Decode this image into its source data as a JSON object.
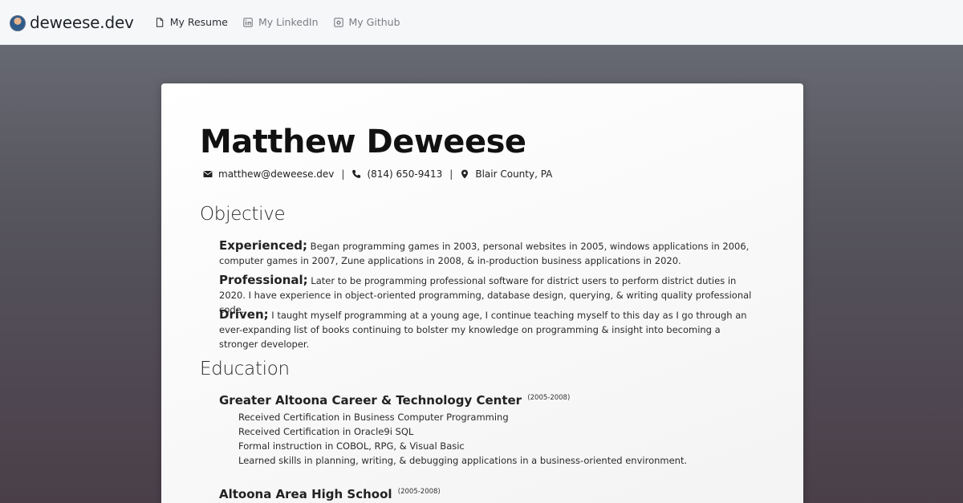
{
  "nav": {
    "brand": "deweese.dev",
    "links": [
      {
        "label": "My Resume",
        "icon": "document-icon",
        "active": true
      },
      {
        "label": "My LinkedIn",
        "icon": "linkedin-icon",
        "active": false
      },
      {
        "label": "My Github",
        "icon": "github-icon",
        "active": false
      }
    ]
  },
  "resume": {
    "name": "Matthew Deweese",
    "contact": {
      "email": "matthew@deweese.dev",
      "phone": "(814) 650-9413",
      "location": "Blair County, PA",
      "separator": "|"
    },
    "objective": {
      "title": "Objective",
      "items": [
        {
          "lead": "Experienced;",
          "text": " Began programming games in 2003, personal websites in 2005, windows applications in 2006, computer games in 2007, Zune applications in 2008, & in-production business applications in 2020."
        },
        {
          "lead": "Professional;",
          "text": " Later to be programming professional software for district users to perform district duties in 2020. I have experience in object-oriented programming, database design, querying, & writing quality professional code."
        },
        {
          "lead": "Driven;",
          "text": " I taught myself programming at a young age, I continue teaching myself to this day as I go through an ever-expanding list of books continuing to bolster my knowledge on programming & insight into becoming a stronger developer."
        }
      ]
    },
    "education": {
      "title": "Education",
      "schools": [
        {
          "name": "Greater Altoona Career & Technology Center",
          "years": "(2005-2008)",
          "items": [
            "Received Certification in Business Computer Programming",
            "Received Certification in Oracle9i SQL",
            "Formal instruction in COBOL, RPG, & Visual Basic",
            "Learned skills in planning, writing, & debugging applications in a business-oriented environment."
          ]
        },
        {
          "name": "Altoona Area High School",
          "years": "(2005-2008)",
          "items": []
        }
      ]
    }
  }
}
